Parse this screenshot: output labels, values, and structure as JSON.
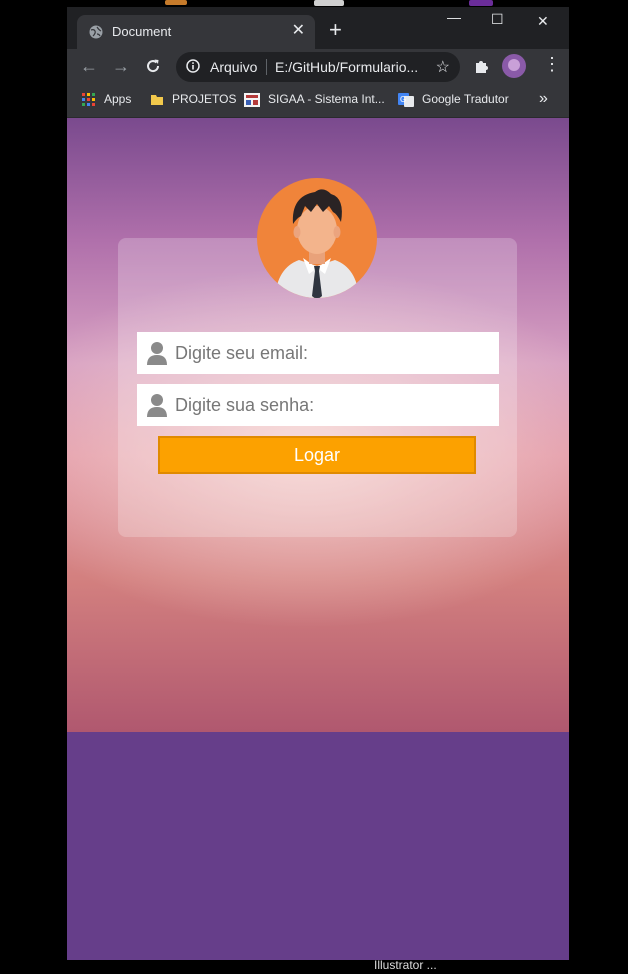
{
  "browser": {
    "tab_title": "Document",
    "new_tab": "+",
    "window_controls": {
      "minimize": "—",
      "maximize": "☐",
      "close": "✕"
    },
    "address": {
      "scheme_label": "Arquivo",
      "url": "E:/GitHub/Formulario..."
    },
    "bookmarks": [
      {
        "label": "Apps",
        "icon": "apps-grid-icon"
      },
      {
        "label": "PROJETOS",
        "icon": "folder-icon"
      },
      {
        "label": "SIGAA - Sistema Int...",
        "icon": "sigaa-icon"
      },
      {
        "label": "Google Tradutor",
        "icon": "google-translate-icon"
      }
    ],
    "bookmarks_overflow": "»"
  },
  "login": {
    "email_placeholder": "Digite seu email:",
    "password_placeholder": "Digite sua senha:",
    "submit_label": "Logar"
  },
  "taskbar": {
    "label": "Illustrator ..."
  },
  "colors": {
    "accent": "#fca100",
    "lower_background": "#663e8a",
    "avatar_bg": "#f0843a"
  }
}
